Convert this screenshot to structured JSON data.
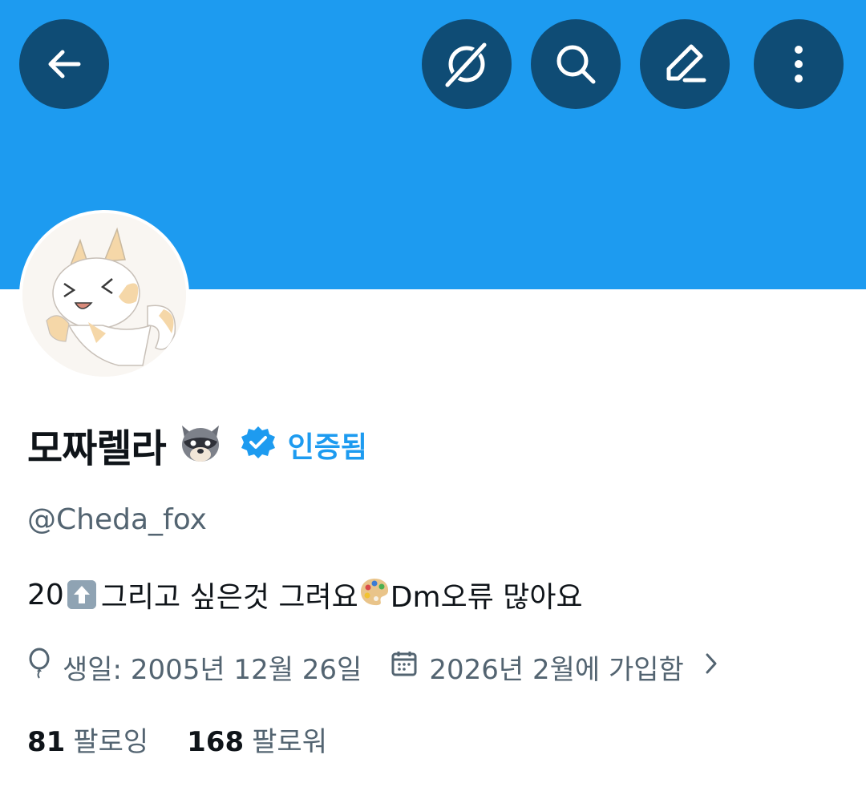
{
  "header": {
    "buttons": [
      {
        "name": "back",
        "icon": "arrow-left-icon"
      },
      {
        "name": "grok",
        "icon": "grok-icon"
      },
      {
        "name": "search",
        "icon": "search-icon"
      },
      {
        "name": "edit",
        "icon": "pencil-icon"
      },
      {
        "name": "more",
        "icon": "more-vertical-icon"
      }
    ],
    "banner_color": "#1d9bf0",
    "button_color": "#0f4c75"
  },
  "profile": {
    "display_name": "모짜렐라",
    "name_emoji": "raccoon-emoji",
    "verified_label": "인증됨",
    "handle": "@Cheda_fox",
    "bio": {
      "part1": "20",
      "part2": " 그리고 싶은것 그려요",
      "part3": " Dm오류 많아요"
    },
    "birthday": "생일: 2005년 12월 26일",
    "joined": "2026년 2월에 가입함",
    "following_count": "81",
    "following_label": "팔로잉",
    "followers_count": "168",
    "followers_label": "팔로워"
  },
  "colors": {
    "accent": "#1d9bf0",
    "muted_text": "#536471",
    "primary_text": "#0f1419"
  }
}
